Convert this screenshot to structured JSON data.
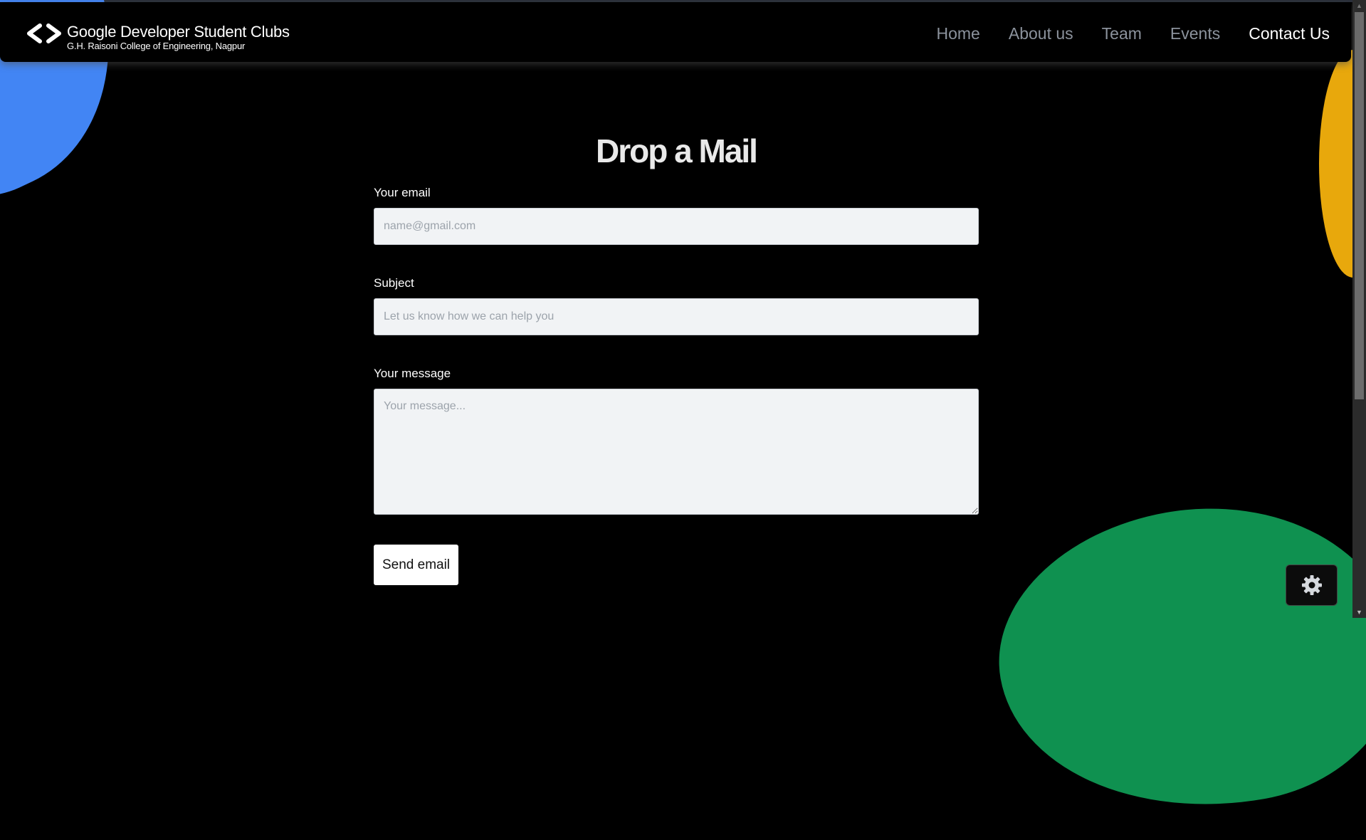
{
  "brand": {
    "title": "Google Developer Student Clubs",
    "subtitle": "G.H. Raisoni College of Engineering, Nagpur",
    "icon": "code-brackets-icon"
  },
  "nav": {
    "items": [
      {
        "label": "Home",
        "active": false
      },
      {
        "label": "About us",
        "active": false
      },
      {
        "label": "Team",
        "active": false
      },
      {
        "label": "Events",
        "active": false
      },
      {
        "label": "Contact Us",
        "active": true
      }
    ]
  },
  "form": {
    "heading": "Drop a Mail",
    "email_label": "Your email",
    "email_placeholder": "name@gmail.com",
    "email_value": "",
    "subject_label": "Subject",
    "subject_placeholder": "Let us know how we can help you",
    "subject_value": "",
    "message_label": "Your message",
    "message_placeholder": "Your message...",
    "message_value": "",
    "submit_label": "Send email"
  },
  "theme_toggle": {
    "icon": "gear-icon"
  },
  "colors": {
    "background": "#000000",
    "blob_blue": "#4285F4",
    "blob_yellow": "#E8A80C",
    "blob_green": "#0F9150",
    "nav_inactive": "#8b929c",
    "nav_active": "#ffffff",
    "input_bg": "#f1f3f5"
  }
}
